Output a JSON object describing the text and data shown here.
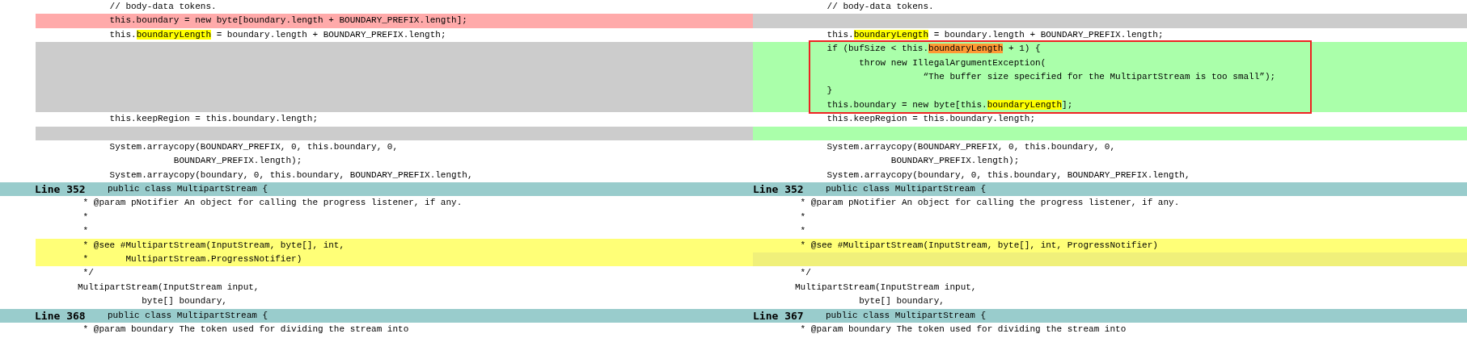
{
  "panes": [
    {
      "kind": "original",
      "rows": [
        {
          "kind": "plain",
          "segments": [
            {
              "kind": "plain",
              "text": "      // body-data tokens."
            }
          ]
        },
        {
          "kind": "removed",
          "segments": [
            {
              "kind": "plain",
              "text": "      this.boundary = new byte[boundary.length + BOUNDARY_PREFIX.length];"
            }
          ]
        },
        {
          "kind": "plain",
          "segments": [
            {
              "kind": "plain",
              "text": "      this."
            },
            {
              "kind": "match",
              "text": "boundaryLength"
            },
            {
              "kind": "plain",
              "text": " = boundary.length + BOUNDARY_PREFIX.length;"
            }
          ]
        },
        {
          "kind": "filler"
        },
        {
          "kind": "filler"
        },
        {
          "kind": "filler"
        },
        {
          "kind": "filler"
        },
        {
          "kind": "filler"
        },
        {
          "kind": "plain",
          "segments": [
            {
              "kind": "plain",
              "text": "      this.keepRegion = this.boundary.length;"
            }
          ]
        },
        {
          "kind": "filler"
        },
        {
          "kind": "plain",
          "segments": [
            {
              "kind": "plain",
              "text": "      System.arraycopy(BOUNDARY_PREFIX, 0, this.boundary, 0,"
            }
          ]
        },
        {
          "kind": "plain",
          "segments": [
            {
              "kind": "plain",
              "text": "                  BOUNDARY_PREFIX.length);"
            }
          ]
        },
        {
          "kind": "plain",
          "segments": [
            {
              "kind": "plain",
              "text": "      System.arraycopy(boundary, 0, this.boundary, BOUNDARY_PREFIX.length,"
            }
          ]
        },
        {
          "kind": "header",
          "label": "Line 352",
          "text": "public class MultipartStream {"
        },
        {
          "kind": "plain",
          "segments": [
            {
              "kind": "plain",
              "text": " * @param pNotifier An object for calling the progress listener, if any."
            }
          ]
        },
        {
          "kind": "plain",
          "segments": [
            {
              "kind": "plain",
              "text": " *"
            }
          ]
        },
        {
          "kind": "plain",
          "segments": [
            {
              "kind": "plain",
              "text": " *"
            }
          ]
        },
        {
          "kind": "changed",
          "segments": [
            {
              "kind": "plain",
              "text": " * @see #MultipartStream(InputStream, byte[], int,"
            }
          ]
        },
        {
          "kind": "changed",
          "segments": [
            {
              "kind": "plain",
              "text": " *       MultipartStream.ProgressNotifier)"
            }
          ]
        },
        {
          "kind": "plain",
          "segments": [
            {
              "kind": "plain",
              "text": " */"
            }
          ]
        },
        {
          "kind": "plain",
          "segments": [
            {
              "kind": "plain",
              "text": "MultipartStream(InputStream input,"
            }
          ]
        },
        {
          "kind": "plain",
          "segments": [
            {
              "kind": "plain",
              "text": "            byte[] boundary,"
            }
          ]
        },
        {
          "kind": "header",
          "label": "Line 368",
          "text": "public class MultipartStream {"
        },
        {
          "kind": "plain",
          "segments": [
            {
              "kind": "plain",
              "text": " * @param boundary The token used for dividing the stream into"
            }
          ]
        }
      ]
    },
    {
      "kind": "revised",
      "rows": [
        {
          "kind": "plain",
          "segments": [
            {
              "kind": "plain",
              "text": "      // body-data tokens."
            }
          ]
        },
        {
          "kind": "filler"
        },
        {
          "kind": "plain",
          "segments": [
            {
              "kind": "plain",
              "text": "      this."
            },
            {
              "kind": "match",
              "text": "boundaryLength"
            },
            {
              "kind": "plain",
              "text": " = boundary.length + BOUNDARY_PREFIX.length;"
            }
          ]
        },
        {
          "kind": "boxed-group",
          "rows": [
            {
              "kind": "added",
              "segments": [
                {
                  "kind": "plain",
                  "text": "      if (bufSize < this."
                },
                {
                  "kind": "new",
                  "text": "boundaryLength"
                },
                {
                  "kind": "plain",
                  "text": " + 1) {"
                }
              ]
            },
            {
              "kind": "added",
              "segments": [
                {
                  "kind": "plain",
                  "text": "            throw new IllegalArgumentException("
                }
              ]
            },
            {
              "kind": "added",
              "segments": [
                {
                  "kind": "plain",
                  "text": "                        “The buffer size specified for the MultipartStream is too small”);"
                }
              ]
            },
            {
              "kind": "added",
              "segments": [
                {
                  "kind": "plain",
                  "text": "      }"
                }
              ]
            },
            {
              "kind": "added",
              "segments": [
                {
                  "kind": "plain",
                  "text": "      this.boundary = new byte[this."
                },
                {
                  "kind": "match",
                  "text": "boundaryLength"
                },
                {
                  "kind": "plain",
                  "text": "];"
                }
              ]
            }
          ]
        },
        {
          "kind": "plain",
          "segments": [
            {
              "kind": "plain",
              "text": "      this.keepRegion = this.boundary.length;"
            }
          ]
        },
        {
          "kind": "added-filler"
        },
        {
          "kind": "plain",
          "segments": [
            {
              "kind": "plain",
              "text": "      System.arraycopy(BOUNDARY_PREFIX, 0, this.boundary, 0,"
            }
          ]
        },
        {
          "kind": "plain",
          "segments": [
            {
              "kind": "plain",
              "text": "                  BOUNDARY_PREFIX.length);"
            }
          ]
        },
        {
          "kind": "plain",
          "segments": [
            {
              "kind": "plain",
              "text": "      System.arraycopy(boundary, 0, this.boundary, BOUNDARY_PREFIX.length,"
            }
          ]
        },
        {
          "kind": "header",
          "label": "Line 352",
          "text": "public class MultipartStream {"
        },
        {
          "kind": "plain",
          "segments": [
            {
              "kind": "plain",
              "text": " * @param pNotifier An object for calling the progress listener, if any."
            }
          ]
        },
        {
          "kind": "plain",
          "segments": [
            {
              "kind": "plain",
              "text": " *"
            }
          ]
        },
        {
          "kind": "plain",
          "segments": [
            {
              "kind": "plain",
              "text": " *"
            }
          ]
        },
        {
          "kind": "changed",
          "segments": [
            {
              "kind": "plain",
              "text": " * @see #MultipartStream(InputStream, byte[], int, ProgressNotifier)"
            }
          ]
        },
        {
          "kind": "changed-filler"
        },
        {
          "kind": "plain",
          "segments": [
            {
              "kind": "plain",
              "text": " */"
            }
          ]
        },
        {
          "kind": "plain",
          "segments": [
            {
              "kind": "plain",
              "text": "MultipartStream(InputStream input,"
            }
          ]
        },
        {
          "kind": "plain",
          "segments": [
            {
              "kind": "plain",
              "text": "            byte[] boundary,"
            }
          ]
        },
        {
          "kind": "header",
          "label": "Line 367",
          "text": "public class MultipartStream {"
        },
        {
          "kind": "plain",
          "segments": [
            {
              "kind": "plain",
              "text": " * @param boundary The token used for dividing the stream into"
            }
          ]
        }
      ]
    }
  ]
}
